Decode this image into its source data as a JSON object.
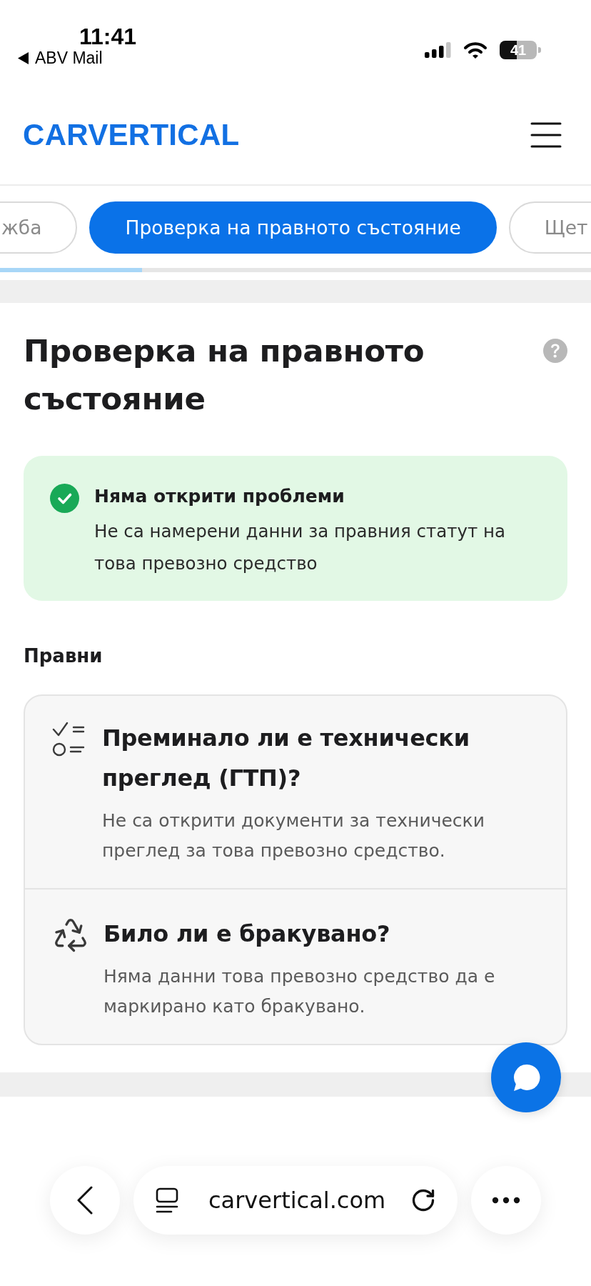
{
  "status_bar": {
    "time": "11:41",
    "back_app": "ABV Mail",
    "battery": "41"
  },
  "header": {
    "logo": "CARVERTICAL"
  },
  "tabs": [
    {
      "label": "жба",
      "selected": false
    },
    {
      "label": "Проверка на правното състояние",
      "selected": true
    },
    {
      "label": "Щет",
      "selected": false
    }
  ],
  "tab_progress": {
    "level": 0.24
  },
  "legal_check": {
    "title": "Проверка на правното състояние",
    "alert": {
      "kind": "success",
      "title": "Няма открити проблеми",
      "text": "Не са намерени данни за правния статут на това превозно средство"
    },
    "group": {
      "title": "Правни",
      "items": [
        {
          "kind": "inspection",
          "title": "Преминало ли е технически преглед (ГТП)?",
          "text": "Не са открити документи за технически преглед за това превозно средство."
        },
        {
          "kind": "scrappage",
          "title": "Било ли е бракувано?",
          "text": "Няма данни това превозно средство да е маркирано като бракувано."
        }
      ]
    }
  },
  "browser_bar": {
    "url": "carvertical.com"
  }
}
